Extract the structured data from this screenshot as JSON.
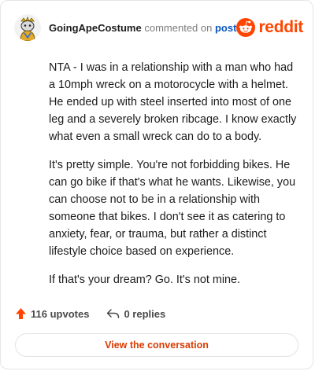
{
  "header": {
    "username": "GoingApeCostume",
    "action_text": "commented on",
    "post_link": "post",
    "brand_name": "reddit",
    "brand_color": "#ff4500",
    "avatar_icon": "snoo-avatar-icon"
  },
  "comment": {
    "paragraphs": [
      "NTA - I was in a relationship with a man who had a 10mph wreck on a motorocycle with a helmet. He ended up with steel inserted into most of one leg and a severely broken ribcage. I know exactly what even a small wreck can do to a body.",
      "It's pretty simple. You're not forbidding bikes. He can go bike if that's what he wants. Likewise, you can choose not to be in a relationship with someone that bikes. I don't see it as catering to anxiety, fear, or trauma, but rather a distinct lifestyle choice based on experience.",
      "If that's your dream? Go. It's not mine."
    ]
  },
  "footer": {
    "upvotes_label": "116 upvotes",
    "replies_label": "0 replies",
    "upvote_icon": "upvote-arrow-icon",
    "reply_icon": "reply-arrow-icon",
    "upvote_color": "#ff4500"
  },
  "actions": {
    "view_conversation_label": "View the conversation",
    "accent_color": "#d93a00"
  }
}
